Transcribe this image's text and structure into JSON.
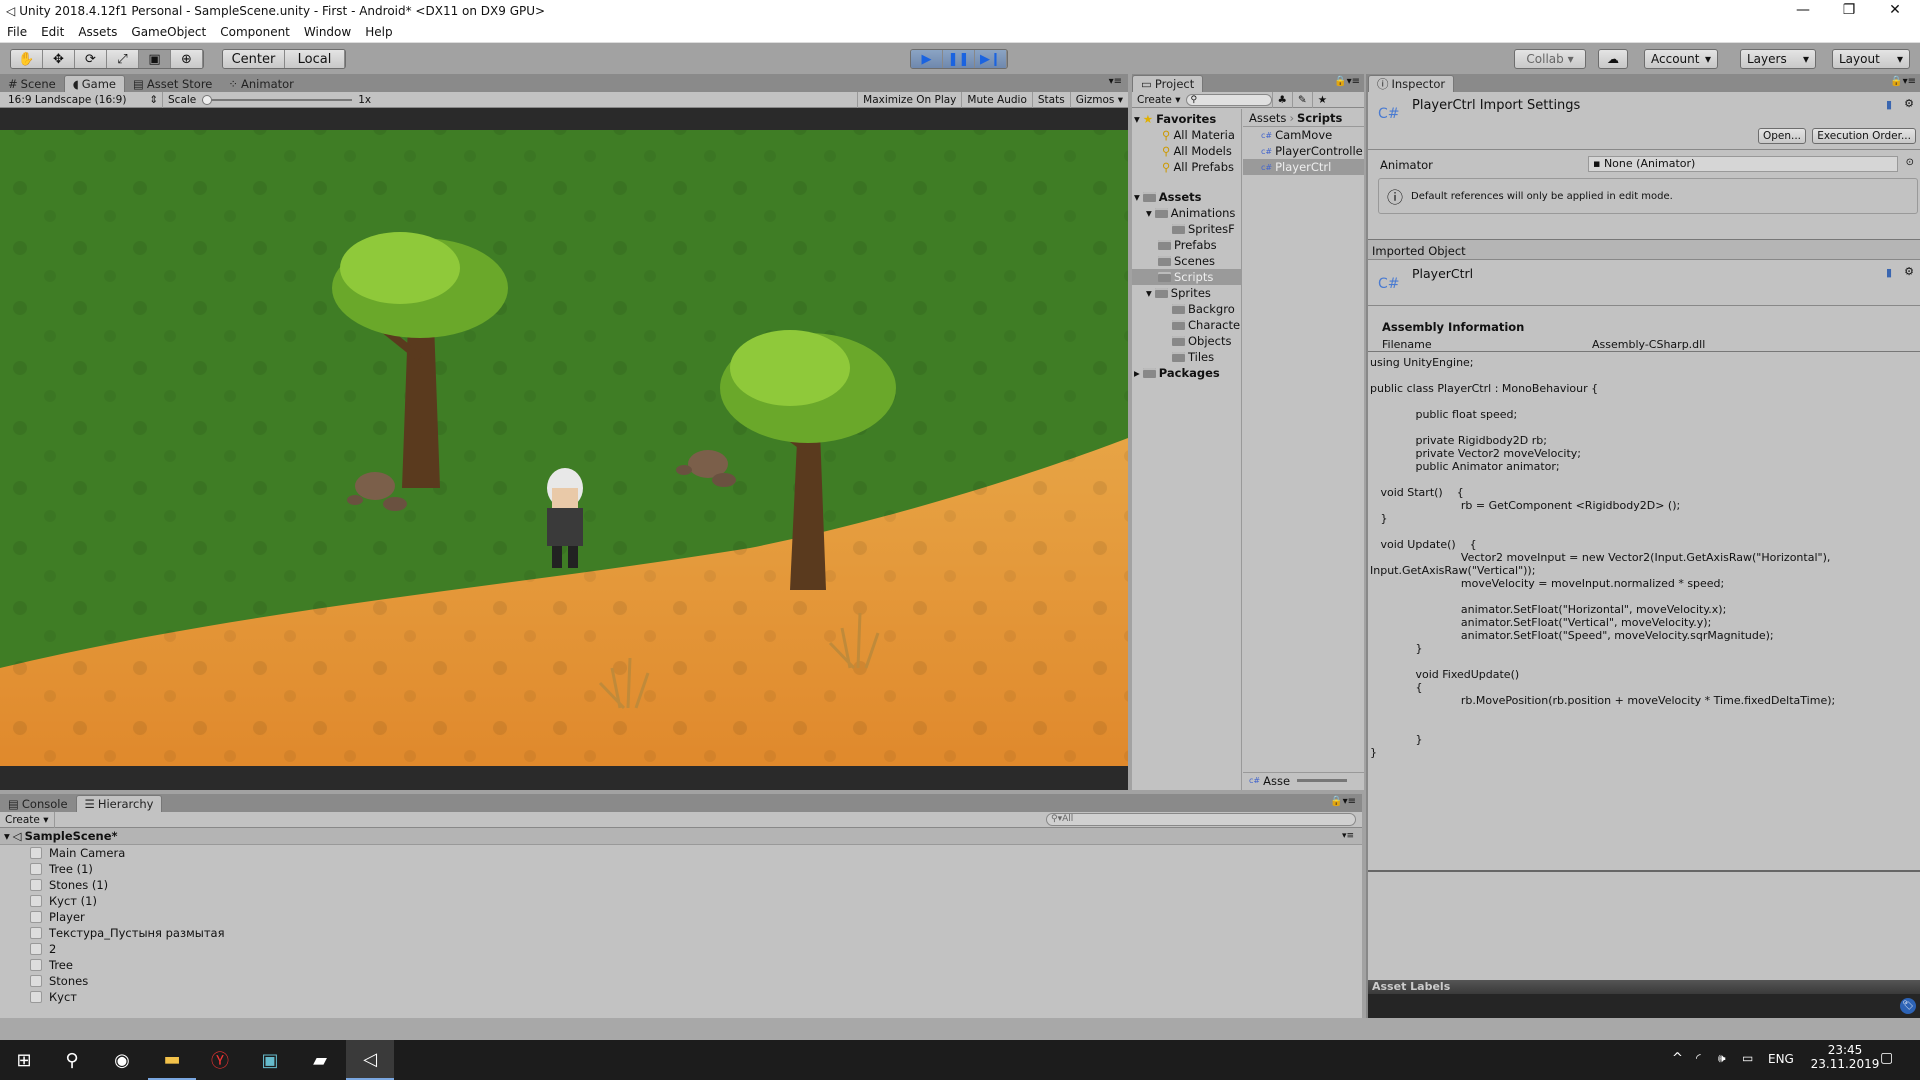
{
  "window": {
    "title": "Unity 2018.4.12f1 Personal - SampleScene.unity - First - Android* <DX11 on DX9 GPU>"
  },
  "menu": [
    "File",
    "Edit",
    "Assets",
    "GameObject",
    "Component",
    "Window",
    "Help"
  ],
  "toolbar": {
    "center": "Center",
    "local": "Local",
    "collab": "Collab",
    "account": "Account",
    "layers": "Layers",
    "layout": "Layout"
  },
  "game_panel": {
    "tabs": [
      "Scene",
      "Game",
      "Asset Store",
      "Animator"
    ],
    "active_tab": "Game",
    "aspect": "16:9 Landscape (16:9)",
    "scale_label": "Scale",
    "scale_value": "1x",
    "buttons": [
      "Maximize On Play",
      "Mute Audio",
      "Stats",
      "Gizmos"
    ]
  },
  "project": {
    "tab": "Project",
    "create": "Create",
    "favorites": {
      "label": "Favorites",
      "items": [
        "All Materia",
        "All Models",
        "All Prefabs"
      ]
    },
    "assets": {
      "label": "Assets",
      "items": [
        {
          "label": "Animations",
          "depth": 1,
          "expanded": true
        },
        {
          "label": "SpritesF",
          "depth": 2
        },
        {
          "label": "Prefabs",
          "depth": 1
        },
        {
          "label": "Scenes",
          "depth": 1
        },
        {
          "label": "Scripts",
          "depth": 1,
          "selected": true
        },
        {
          "label": "Sprites",
          "depth": 1,
          "expanded": true
        },
        {
          "label": "Backgro",
          "depth": 2
        },
        {
          "label": "Characte",
          "depth": 2
        },
        {
          "label": "Objects",
          "depth": 2
        },
        {
          "label": "Tiles",
          "depth": 2
        }
      ]
    },
    "packages": "Packages",
    "breadcrumb": [
      "Assets",
      "Scripts"
    ],
    "files": [
      "CamMove",
      "PlayerControlle",
      "PlayerCtrl"
    ],
    "selected_file": "PlayerCtrl",
    "footer": "Asse"
  },
  "inspector": {
    "tab": "Inspector",
    "title": "PlayerCtrl Import Settings",
    "open": "Open...",
    "exec_order": "Execution Order...",
    "animator_label": "Animator",
    "animator_value": "None (Animator)",
    "info": "Default references will only be applied in edit mode.",
    "imported_object": "Imported Object",
    "object_name": "PlayerCtrl",
    "assembly_header": "Assembly Information",
    "filename_label": "Filename",
    "filename_value": "Assembly-CSharp.dll",
    "code": "using UnityEngine;\n\npublic class PlayerCtrl : MonoBehaviour {\n\n             public float speed;\n\n             private Rigidbody2D rb;\n             private Vector2 moveVelocity;\n             public Animator animator;\n\n   void Start()    {\n                          rb = GetComponent <Rigidbody2D> ();\n   }\n\n   void Update()    {\n                          Vector2 moveInput = new Vector2(Input.GetAxisRaw(\"Horizontal\"),\nInput.GetAxisRaw(\"Vertical\"));\n                          moveVelocity = moveInput.normalized * speed;\n\n                          animator.SetFloat(\"Horizontal\", moveVelocity.x);\n                          animator.SetFloat(\"Vertical\", moveVelocity.y);\n                          animator.SetFloat(\"Speed\", moveVelocity.sqrMagnitude);\n             }\n\n             void FixedUpdate()\n             {\n                          rb.MovePosition(rb.position + moveVelocity * Time.fixedDeltaTime);\n\n\n             }\n}",
    "asset_labels": "Asset Labels"
  },
  "hierarchy": {
    "tabs": [
      "Console",
      "Hierarchy"
    ],
    "active_tab": "Hierarchy",
    "create": "Create",
    "search_placeholder": "All",
    "scene": "SampleScene*",
    "items": [
      "Main Camera",
      "Tree (1)",
      "Stones (1)",
      "Куст (1)",
      "Player",
      "Текстура_Пустыня размытая",
      "2",
      "Tree",
      "Stones",
      "Куст"
    ]
  },
  "taskbar": {
    "time": "23:45",
    "date": "23.11.2019",
    "lang": "ENG"
  },
  "colors": {
    "accent": "#1a63e0",
    "grass": "#3f7d25",
    "sand": "#e69a3c",
    "panel": "#c2c2c2"
  }
}
